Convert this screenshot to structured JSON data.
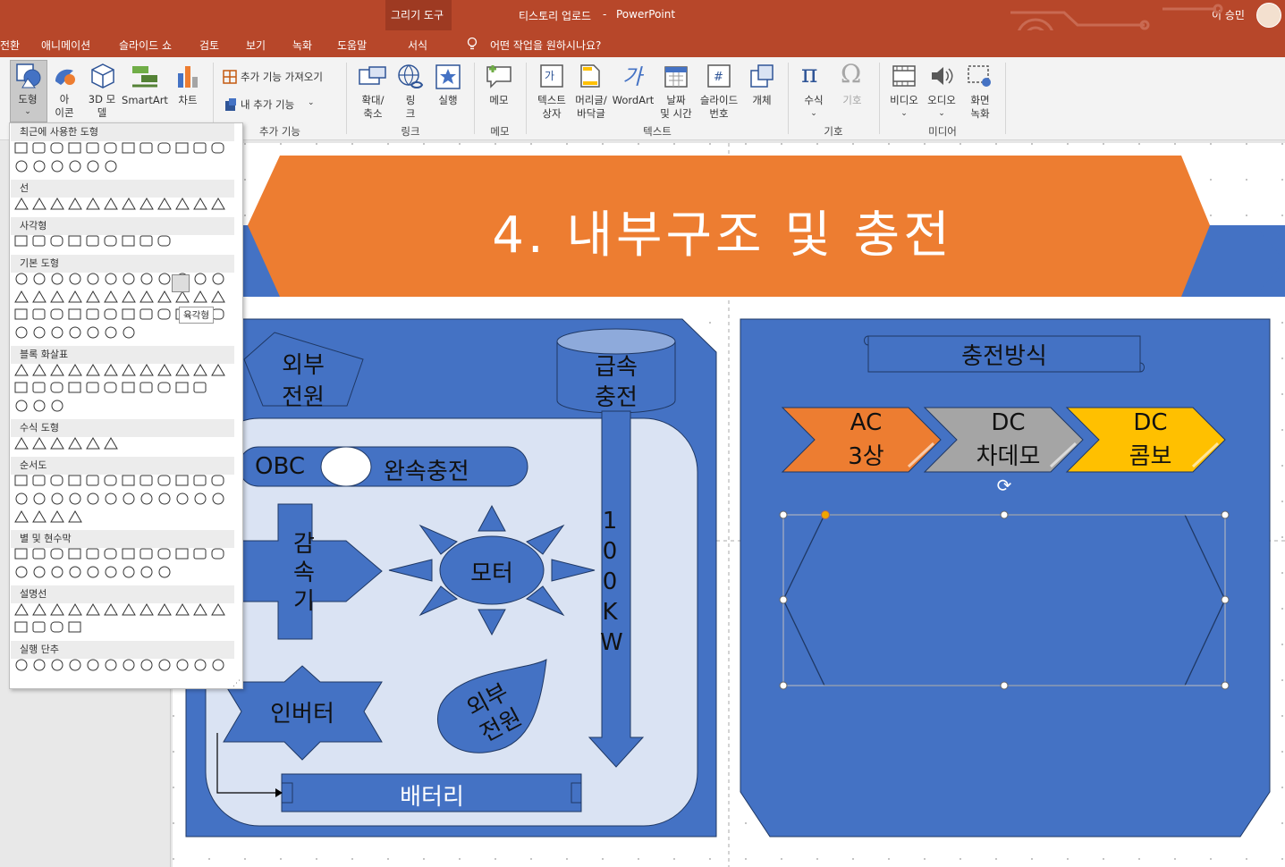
{
  "window": {
    "context_tab_group": "그리기 도구",
    "document_title": "티스토리 업로드",
    "app_name": "PowerPoint",
    "title_separator": "-",
    "user_name": "이 승민"
  },
  "tabs": [
    "전환",
    "애니메이션",
    "슬라이드 쇼",
    "검토",
    "보기",
    "녹화",
    "도움말",
    "서식"
  ],
  "tell_me": "어떤 작업을 원하시나요?",
  "ribbon": {
    "shapes": "도형",
    "icons": [
      "아",
      "이콘"
    ],
    "model3d": [
      "3D 모",
      "델"
    ],
    "smartart": "SmartArt",
    "chart": "차트",
    "get_addins": "추가 기능 가져오기",
    "my_addins": "내 추가 기능",
    "addins_group": "추가 기능",
    "zoom": [
      "확대/",
      "축소"
    ],
    "link": [
      "링",
      "크"
    ],
    "action": "실행",
    "links_group": "링크",
    "comment": "메모",
    "comments_group": "메모",
    "textbox": [
      "텍스트",
      "상자"
    ],
    "header_footer": [
      "머리글/",
      "바닥글"
    ],
    "wordart": "WordArt",
    "datetime": [
      "날짜",
      "및 시간"
    ],
    "slide_number": [
      "슬라이드",
      "번호"
    ],
    "object": "개체",
    "text_group": "텍스트",
    "equation": "수식",
    "symbol": "기호",
    "symbols_group": "기호",
    "video": "비디오",
    "audio": "오디오",
    "screen_record": [
      "화면",
      "녹화"
    ],
    "media_group": "미디어"
  },
  "gallery": {
    "sections": [
      "최근에 사용한 도형",
      "선",
      "사각형",
      "기본 도형",
      "블록 화살표",
      "수식 도형",
      "순서도",
      "별 및 현수막",
      "설명선",
      "실행 단추"
    ],
    "tooltip": "육각형"
  },
  "slide": {
    "title": "4. 내부구조 및 충전",
    "left": {
      "external_power_top": [
        "외부",
        "전원"
      ],
      "fast_charge": [
        "급속",
        "충전"
      ],
      "obc": "OBC",
      "slow_charge": "완속충전",
      "reducer": [
        "감",
        "속",
        "기"
      ],
      "motor": "모터",
      "kw100": [
        "1",
        "0",
        "0",
        "K",
        "W"
      ],
      "inverter": "인버터",
      "external_power_bottom": [
        "외부",
        "전원"
      ],
      "battery": "배터리"
    },
    "right": {
      "charging_method": "충전방식",
      "chevrons": [
        {
          "line1": "AC",
          "line2": "3상",
          "color": "#ed7d31"
        },
        {
          "line1": "DC",
          "line2": "차데모",
          "color": "#a5a5a5"
        },
        {
          "line1": "DC",
          "line2": "콤보",
          "color": "#ffc000"
        }
      ]
    }
  },
  "colors": {
    "ribbon_red": "#b7472a",
    "slide_blue": "#4472c4",
    "slide_orange": "#ed7d31",
    "light_fill": "#dae3f3"
  }
}
